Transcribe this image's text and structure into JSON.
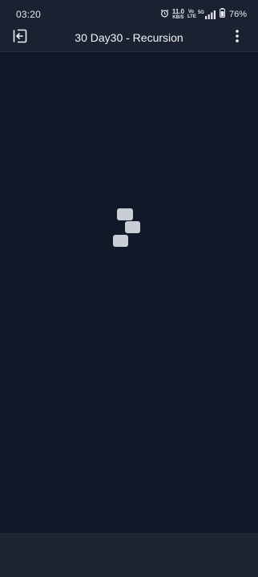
{
  "status_bar": {
    "time": "03:20",
    "net_speed_value": "11.0",
    "net_speed_unit": "KB/S",
    "network_label": "5G",
    "volte_label": "Vo LTE",
    "battery_percent": "76%",
    "icons": [
      "alarm-icon",
      "volte-icon",
      "signal-icon",
      "battery-icon"
    ]
  },
  "app_bar": {
    "title": "30 Day30 - Recursion",
    "icons": [
      "exit-icon",
      "more-vert-icon"
    ]
  },
  "main": {
    "loading_indicator": "loading-blocks-icon"
  },
  "colors": {
    "background": "#111827",
    "app_bar": "#1a2130",
    "loader": "#c9ced4",
    "bottom_bar": "#1f2431"
  }
}
